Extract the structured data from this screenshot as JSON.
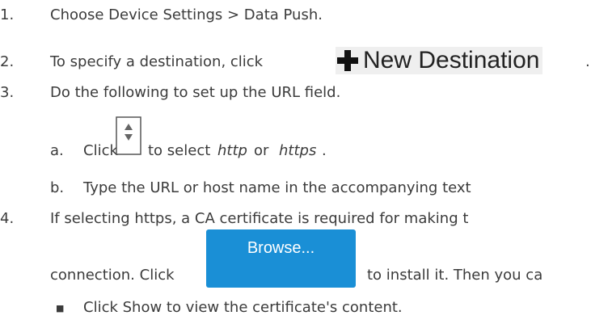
{
  "steps": [
    {
      "num": "1.",
      "text": "Choose Device Settings > Data Push."
    },
    {
      "num": "2.",
      "text_before": "To specify a destination, click",
      "button_label": "New Destination",
      "text_after": "."
    },
    {
      "num": "3.",
      "text": "Do the following to set up the URL field."
    },
    {
      "num": "4.",
      "text": "If selecting https, a CA certificate is required for making t"
    }
  ],
  "substeps": [
    {
      "letter": "a.",
      "click": "Click",
      "mid": "to select",
      "opt1": "http",
      "or": "or",
      "opt2": "https",
      "end": "."
    },
    {
      "letter": "b.",
      "text": "Type the URL or host name in the accompanying text"
    }
  ],
  "step4_cont": {
    "before": "connection. Click",
    "browse_label": "Browse...",
    "after": "to install it. Then you ca"
  },
  "bullets": [
    {
      "text": "Click Show to view the certificate's content."
    }
  ],
  "icons": {
    "plus": "plus-icon",
    "spinner": "spinner-updown-icon"
  },
  "colors": {
    "text": "#3b3b3b",
    "browse_bg": "#1a8fd6",
    "new_dest_bg": "#efefef"
  }
}
